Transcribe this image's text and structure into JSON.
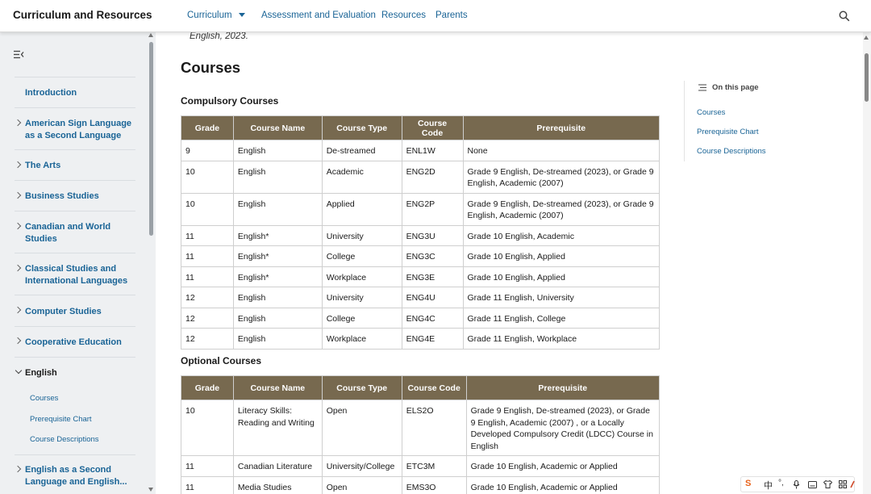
{
  "header": {
    "brand": "Curriculum and Resources",
    "nav": [
      {
        "label": "Curriculum",
        "has_dropdown": true
      },
      {
        "label": "Assessment and Evaluation"
      },
      {
        "label": "Resources"
      },
      {
        "label": "Parents"
      }
    ],
    "search_icon": "search-icon"
  },
  "sidebar": {
    "collapse_icon": "sidebar-collapse-icon",
    "items": [
      {
        "label": "Introduction",
        "expandable": false
      },
      {
        "label": "American Sign Language as a Second Language",
        "expandable": true
      },
      {
        "label": "The Arts",
        "expandable": true
      },
      {
        "label": "Business Studies",
        "expandable": true
      },
      {
        "label": "Canadian and World Studies",
        "expandable": true
      },
      {
        "label": "Classical Studies and International Languages",
        "expandable": true
      },
      {
        "label": "Computer Studies",
        "expandable": true
      },
      {
        "label": "Cooperative Education",
        "expandable": true
      },
      {
        "label": "English",
        "expandable": true,
        "expanded": true
      },
      {
        "label": "English as a Second Language and English...",
        "expandable": true
      }
    ],
    "english_sub": [
      "Courses",
      "Prerequisite Chart",
      "Course Descriptions"
    ]
  },
  "main": {
    "citation_tail": "English, 2023.",
    "title": "Courses",
    "compulsory_title": "Compulsory Courses",
    "optional_title": "Optional Courses",
    "columns": [
      "Grade",
      "Course Name",
      "Course Type",
      "Course Code",
      "Prerequisite"
    ],
    "compulsory_rows": [
      [
        "9",
        "English",
        "De-streamed",
        "ENL1W",
        "None"
      ],
      [
        "10",
        "English",
        "Academic",
        "ENG2D",
        "Grade 9 English, De-streamed (2023), or Grade 9 English, Academic (2007)"
      ],
      [
        "10",
        "English",
        "Applied",
        "ENG2P",
        "Grade 9 English, De-streamed (2023), or Grade 9 English, Academic (2007)"
      ],
      [
        "11",
        "English*",
        "University",
        "ENG3U",
        "Grade 10 English, Academic"
      ],
      [
        "11",
        "English*",
        "College",
        "ENG3C",
        "Grade 10 English, Applied"
      ],
      [
        "11",
        "English*",
        "Workplace",
        "ENG3E",
        "Grade 10 English, Applied"
      ],
      [
        "12",
        "English",
        "University",
        "ENG4U",
        "Grade 11 English, University"
      ],
      [
        "12",
        "English",
        "College",
        "ENG4C",
        "Grade 11 English, College"
      ],
      [
        "12",
        "English",
        "Workplace",
        "ENG4E",
        "Grade 11 English, Workplace"
      ]
    ],
    "optional_rows": [
      [
        "10",
        "Literacy Skills: Reading and Writing",
        "Open",
        "ELS2O",
        "Grade 9 English, De-streamed (2023), or Grade 9 English, Academic (2007) , or a Locally Developed Compulsory Credit (LDCC) Course in English"
      ],
      [
        "11",
        "Canadian Literature",
        "University/College",
        "ETC3M",
        "Grade 10 English, Academic or Applied"
      ],
      [
        "11",
        "Media Studies",
        "Open",
        "EMS3O",
        "Grade 10 English, Academic or Applied"
      ]
    ]
  },
  "on_this_page": {
    "title": "On this page",
    "links": [
      "Courses",
      "Prerequisite Chart",
      "Course Descriptions"
    ]
  },
  "ime_toolbar": {
    "logo": "S",
    "lang": "中",
    "items": [
      "punctuation-icon",
      "microphone-icon",
      "keyboard-icon",
      "shirt-icon",
      "grid-icon",
      "tools-icon"
    ]
  },
  "colors": {
    "link": "#1a6496",
    "table_header": "#77694f",
    "sidebar_bg": "#eef0f2"
  }
}
